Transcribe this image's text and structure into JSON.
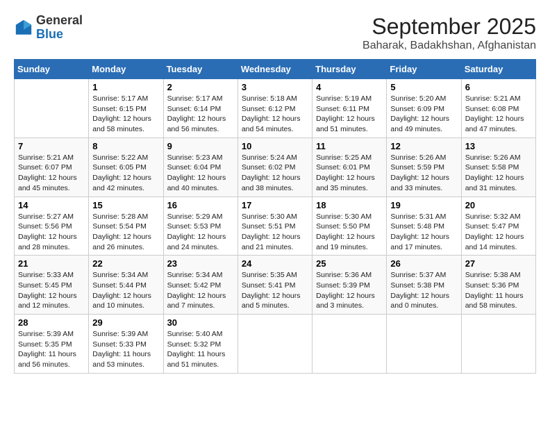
{
  "header": {
    "logo_general": "General",
    "logo_blue": "Blue",
    "month_year": "September 2025",
    "location": "Baharak, Badakhshan, Afghanistan"
  },
  "calendar": {
    "days_of_week": [
      "Sunday",
      "Monday",
      "Tuesday",
      "Wednesday",
      "Thursday",
      "Friday",
      "Saturday"
    ],
    "weeks": [
      [
        {
          "day": "",
          "content": ""
        },
        {
          "day": "1",
          "content": "Sunrise: 5:17 AM\nSunset: 6:15 PM\nDaylight: 12 hours\nand 58 minutes."
        },
        {
          "day": "2",
          "content": "Sunrise: 5:17 AM\nSunset: 6:14 PM\nDaylight: 12 hours\nand 56 minutes."
        },
        {
          "day": "3",
          "content": "Sunrise: 5:18 AM\nSunset: 6:12 PM\nDaylight: 12 hours\nand 54 minutes."
        },
        {
          "day": "4",
          "content": "Sunrise: 5:19 AM\nSunset: 6:11 PM\nDaylight: 12 hours\nand 51 minutes."
        },
        {
          "day": "5",
          "content": "Sunrise: 5:20 AM\nSunset: 6:09 PM\nDaylight: 12 hours\nand 49 minutes."
        },
        {
          "day": "6",
          "content": "Sunrise: 5:21 AM\nSunset: 6:08 PM\nDaylight: 12 hours\nand 47 minutes."
        }
      ],
      [
        {
          "day": "7",
          "content": "Sunrise: 5:21 AM\nSunset: 6:07 PM\nDaylight: 12 hours\nand 45 minutes."
        },
        {
          "day": "8",
          "content": "Sunrise: 5:22 AM\nSunset: 6:05 PM\nDaylight: 12 hours\nand 42 minutes."
        },
        {
          "day": "9",
          "content": "Sunrise: 5:23 AM\nSunset: 6:04 PM\nDaylight: 12 hours\nand 40 minutes."
        },
        {
          "day": "10",
          "content": "Sunrise: 5:24 AM\nSunset: 6:02 PM\nDaylight: 12 hours\nand 38 minutes."
        },
        {
          "day": "11",
          "content": "Sunrise: 5:25 AM\nSunset: 6:01 PM\nDaylight: 12 hours\nand 35 minutes."
        },
        {
          "day": "12",
          "content": "Sunrise: 5:26 AM\nSunset: 5:59 PM\nDaylight: 12 hours\nand 33 minutes."
        },
        {
          "day": "13",
          "content": "Sunrise: 5:26 AM\nSunset: 5:58 PM\nDaylight: 12 hours\nand 31 minutes."
        }
      ],
      [
        {
          "day": "14",
          "content": "Sunrise: 5:27 AM\nSunset: 5:56 PM\nDaylight: 12 hours\nand 28 minutes."
        },
        {
          "day": "15",
          "content": "Sunrise: 5:28 AM\nSunset: 5:54 PM\nDaylight: 12 hours\nand 26 minutes."
        },
        {
          "day": "16",
          "content": "Sunrise: 5:29 AM\nSunset: 5:53 PM\nDaylight: 12 hours\nand 24 minutes."
        },
        {
          "day": "17",
          "content": "Sunrise: 5:30 AM\nSunset: 5:51 PM\nDaylight: 12 hours\nand 21 minutes."
        },
        {
          "day": "18",
          "content": "Sunrise: 5:30 AM\nSunset: 5:50 PM\nDaylight: 12 hours\nand 19 minutes."
        },
        {
          "day": "19",
          "content": "Sunrise: 5:31 AM\nSunset: 5:48 PM\nDaylight: 12 hours\nand 17 minutes."
        },
        {
          "day": "20",
          "content": "Sunrise: 5:32 AM\nSunset: 5:47 PM\nDaylight: 12 hours\nand 14 minutes."
        }
      ],
      [
        {
          "day": "21",
          "content": "Sunrise: 5:33 AM\nSunset: 5:45 PM\nDaylight: 12 hours\nand 12 minutes."
        },
        {
          "day": "22",
          "content": "Sunrise: 5:34 AM\nSunset: 5:44 PM\nDaylight: 12 hours\nand 10 minutes."
        },
        {
          "day": "23",
          "content": "Sunrise: 5:34 AM\nSunset: 5:42 PM\nDaylight: 12 hours\nand 7 minutes."
        },
        {
          "day": "24",
          "content": "Sunrise: 5:35 AM\nSunset: 5:41 PM\nDaylight: 12 hours\nand 5 minutes."
        },
        {
          "day": "25",
          "content": "Sunrise: 5:36 AM\nSunset: 5:39 PM\nDaylight: 12 hours\nand 3 minutes."
        },
        {
          "day": "26",
          "content": "Sunrise: 5:37 AM\nSunset: 5:38 PM\nDaylight: 12 hours\nand 0 minutes."
        },
        {
          "day": "27",
          "content": "Sunrise: 5:38 AM\nSunset: 5:36 PM\nDaylight: 11 hours\nand 58 minutes."
        }
      ],
      [
        {
          "day": "28",
          "content": "Sunrise: 5:39 AM\nSunset: 5:35 PM\nDaylight: 11 hours\nand 56 minutes."
        },
        {
          "day": "29",
          "content": "Sunrise: 5:39 AM\nSunset: 5:33 PM\nDaylight: 11 hours\nand 53 minutes."
        },
        {
          "day": "30",
          "content": "Sunrise: 5:40 AM\nSunset: 5:32 PM\nDaylight: 11 hours\nand 51 minutes."
        },
        {
          "day": "",
          "content": ""
        },
        {
          "day": "",
          "content": ""
        },
        {
          "day": "",
          "content": ""
        },
        {
          "day": "",
          "content": ""
        }
      ]
    ]
  }
}
